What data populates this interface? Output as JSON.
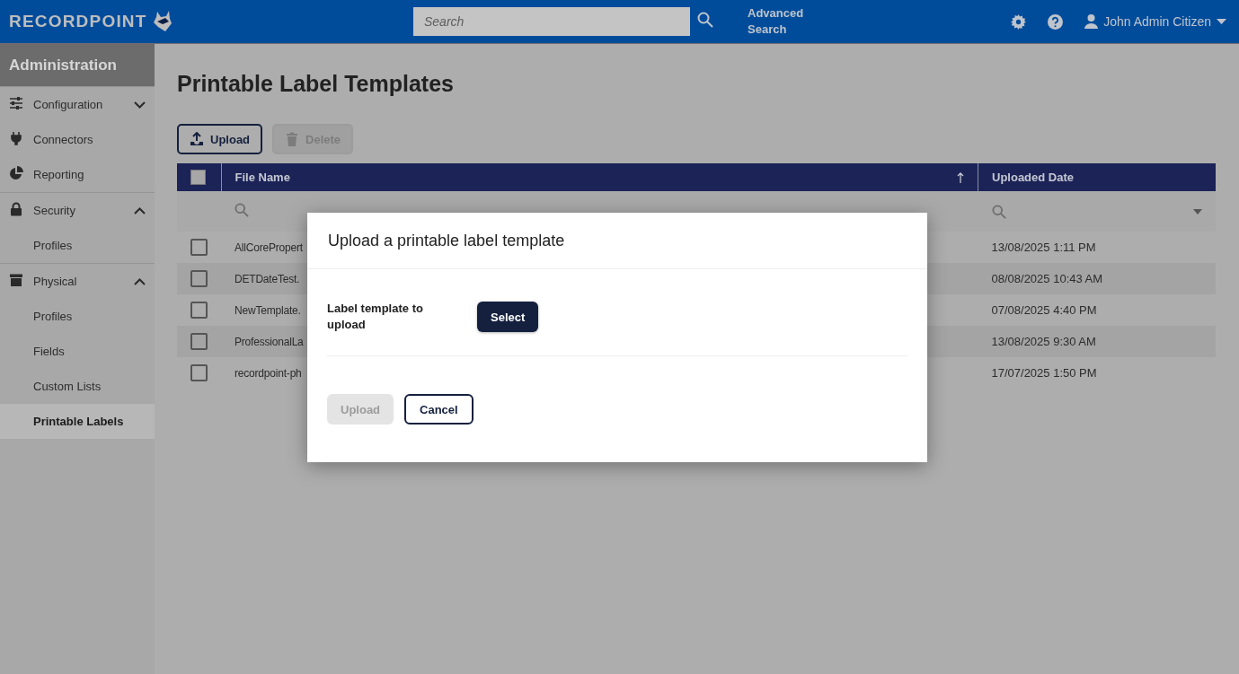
{
  "header": {
    "logo": "RECORDPOINT",
    "search": {
      "placeholder": "Search"
    },
    "advanced_search": "Advanced Search",
    "user": "John Admin Citizen"
  },
  "sidebar": {
    "title": "Administration",
    "items": [
      {
        "label": "Configuration",
        "expanded": false,
        "selected": false
      },
      {
        "label": "Connectors",
        "selected": false
      },
      {
        "label": "Reporting",
        "selected": false
      },
      {
        "label": "Security",
        "expanded": true,
        "selected": false,
        "children": [
          {
            "label": "Profiles",
            "selected": false
          }
        ]
      },
      {
        "label": "Physical",
        "expanded": true,
        "selected": false,
        "children": [
          {
            "label": "Profiles",
            "selected": false
          },
          {
            "label": "Fields",
            "selected": false
          },
          {
            "label": "Custom Lists",
            "selected": false
          },
          {
            "label": "Printable Labels",
            "selected": true
          }
        ]
      }
    ]
  },
  "page_title": "Printable Label Templates",
  "toolbar": [
    {
      "label": "Upload",
      "disabled": false
    },
    {
      "label": "Delete",
      "disabled": true
    }
  ],
  "table": {
    "select_all_checked": false,
    "columns": [
      "File Name",
      "Uploaded Date"
    ],
    "sorted_ascending": true,
    "rows": [
      {
        "checked": false,
        "file_name": "AllCorePropert",
        "uploaded_date": "13/08/2025 1:11 PM"
      },
      {
        "checked": false,
        "file_name": "DETDateTest.",
        "uploaded_date": "08/08/2025 10:43 AM"
      },
      {
        "checked": false,
        "file_name": "NewTemplate.",
        "uploaded_date": "07/08/2025 4:40 PM"
      },
      {
        "checked": false,
        "file_name": "ProfessionalLa",
        "uploaded_date": "13/08/2025 9:30 AM"
      },
      {
        "checked": false,
        "file_name": "recordpoint-ph",
        "uploaded_date": "17/07/2025 1:50 PM"
      }
    ]
  },
  "dialog": {
    "title": "Upload a printable label template",
    "field_label": "Label template to upload",
    "select_button": "Select",
    "buttons": [
      {
        "label": "Upload",
        "disabled": true
      },
      {
        "label": "Cancel",
        "disabled": false
      }
    ]
  }
}
